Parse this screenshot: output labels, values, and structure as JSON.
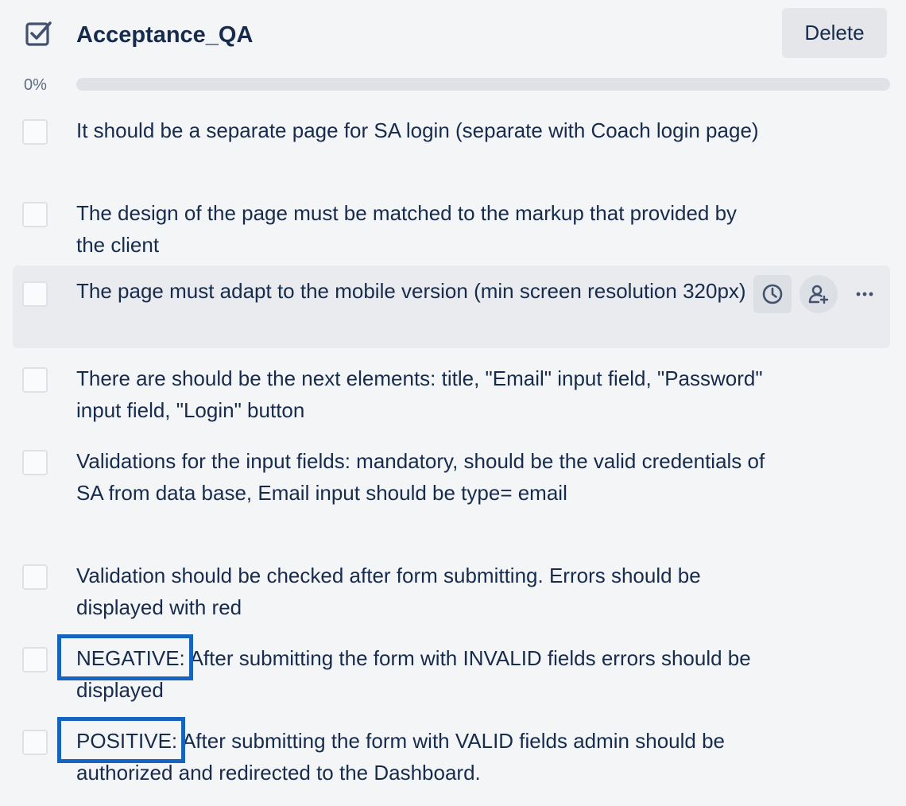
{
  "checklist": {
    "title": "Acceptance_QA",
    "delete_label": "Delete",
    "progress_label": "0%",
    "progress_fraction": 0
  },
  "items": [
    {
      "text": "It should be a separate page for SA login (separate with Coach login page)"
    },
    {
      "text": "The design of the page must be matched to the markup that provided by the client"
    },
    {
      "text": "The page must adapt to the mobile version (min screen resolution 320px)"
    },
    {
      "text": "There are should be the next elements: title, \"Email\" input field, \"Password\" input field, \"Login\" button"
    },
    {
      "text": "Validations for the input fields: mandatory, should be the valid credentials of SA from data base, Email input should be type= email"
    },
    {
      "text": "Validation should be checked after form submitting. Errors should be displayed with red"
    },
    {
      "tag": "NEGATIVE:",
      "text": "After submitting the form with INVALID fields errors should be displayed"
    },
    {
      "tag": "POSITIVE:",
      "text": "After submitting the form with VALID fields admin should be authorized and redirected to the Dashboard."
    }
  ],
  "icons": {
    "header": "checklist-icon",
    "due_date": "clock-icon",
    "assign": "add-member-icon",
    "more": "more-icon"
  },
  "colors": {
    "background": "#f4f5f7",
    "text": "#172b4d",
    "highlight_box": "#1763c0"
  }
}
